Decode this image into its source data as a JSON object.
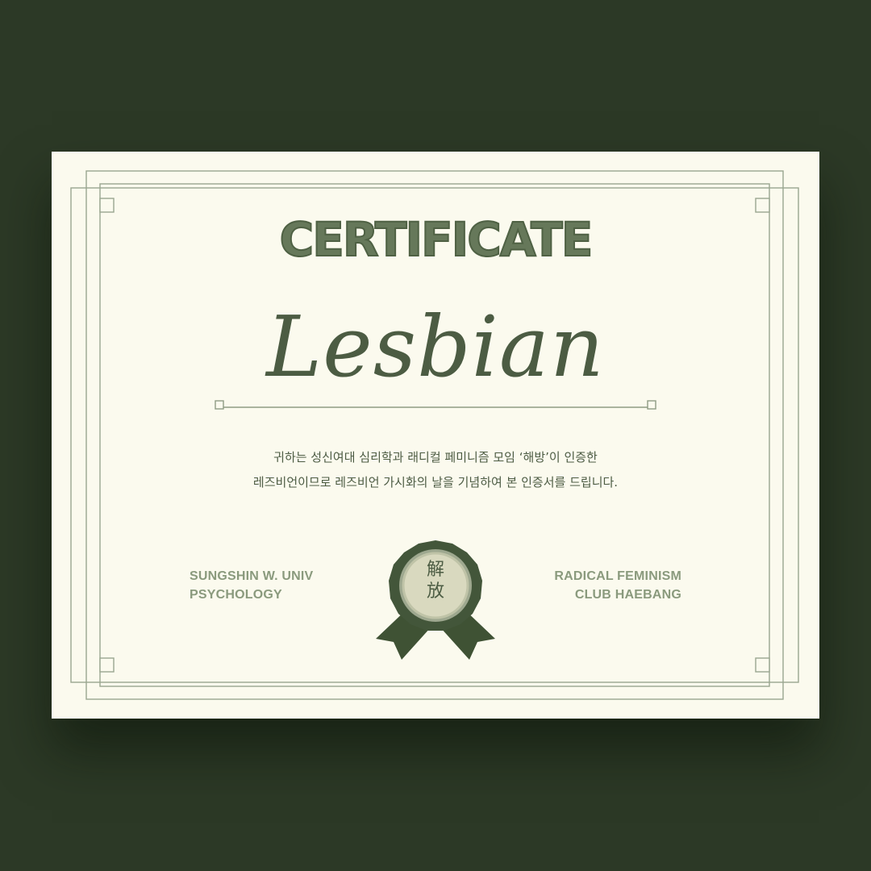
{
  "certificate": {
    "title": "CERTIFICATE",
    "headline": "Lesbian",
    "body_line_1": "귀하는 성신여대 심리학과 래디컬 페미니즘 모임 ‘해방’이 인증한",
    "body_line_2": "레즈비언이므로 레즈비언 가시화의 날을 기념하여 본 인증서를 드립니다.",
    "left_org_line_1": "SUNGSHIN W. UNIV",
    "left_org_line_2": "PSYCHOLOGY",
    "right_org_line_1": "RADICAL FEMINISM",
    "right_org_line_2": "CLUB HAEBANG",
    "seal_char_1": "解",
    "seal_char_2": "放",
    "seal_icon": "award-rosette-icon"
  },
  "colors": {
    "background": "#2c3926",
    "paper": "#fbfaee",
    "accent_green": "#4c5c43",
    "muted_green": "#8a9a7d"
  }
}
